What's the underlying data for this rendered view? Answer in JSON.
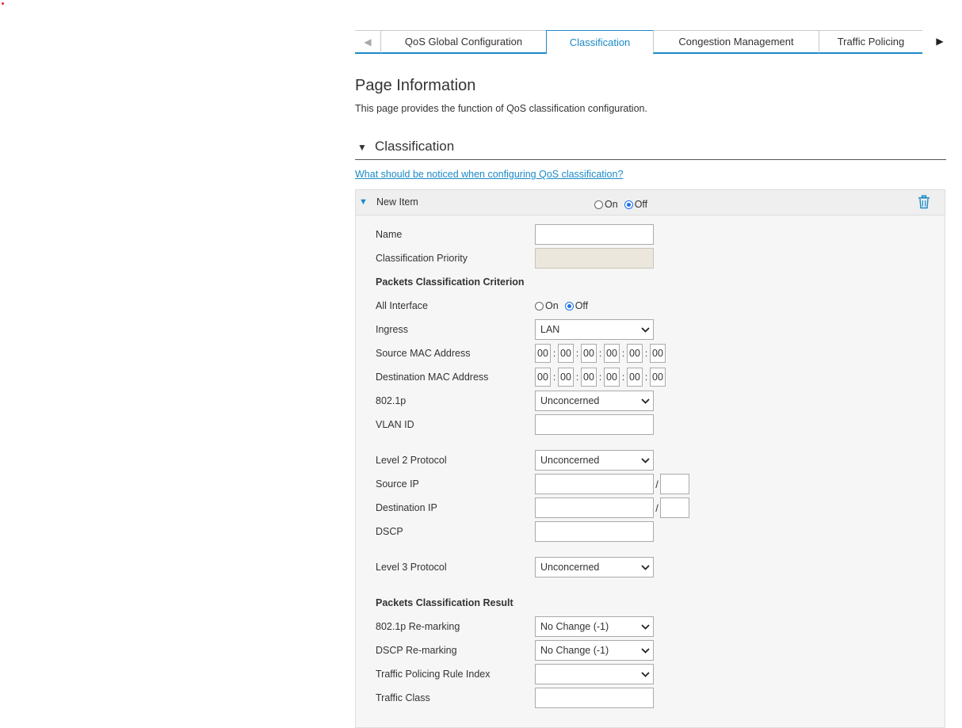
{
  "tabs": [
    {
      "label": "QoS Global Configuration",
      "active": false
    },
    {
      "label": "Classification",
      "active": true
    },
    {
      "label": "Congestion Management",
      "active": false
    },
    {
      "label": "Traffic Policing",
      "active": false
    }
  ],
  "page_info": {
    "title": "Page Information",
    "description": "This page provides the function of QoS classification configuration."
  },
  "section": {
    "title": "Classification",
    "help_link": "What should be noticed when configuring QoS classification?"
  },
  "item": {
    "title": "New Item",
    "on_label": "On",
    "off_label": "Off",
    "state": "Off"
  },
  "form": {
    "name_label": "Name",
    "name_value": "",
    "priority_label": "Classification Priority",
    "priority_value": "",
    "criterion_heading": "Packets Classification Criterion",
    "all_interface_label": "All Interface",
    "all_interface_on": "On",
    "all_interface_off": "Off",
    "all_interface_state": "Off",
    "ingress_label": "Ingress",
    "ingress_value": "LAN",
    "src_mac_label": "Source MAC Address",
    "src_mac": [
      "00",
      "00",
      "00",
      "00",
      "00",
      "00"
    ],
    "dst_mac_label": "Destination MAC Address",
    "dst_mac": [
      "00",
      "00",
      "00",
      "00",
      "00",
      "00"
    ],
    "dot1p_label": "802.1p",
    "dot1p_value": "Unconcerned",
    "vlan_label": "VLAN ID",
    "vlan_value": "",
    "l2_label": "Level 2 Protocol",
    "l2_value": "Unconcerned",
    "src_ip_label": "Source IP",
    "dst_ip_label": "Destination IP",
    "ip_separator": "/",
    "dscp_label": "DSCP",
    "dscp_value": "",
    "l3_label": "Level 3 Protocol",
    "l3_value": "Unconcerned",
    "result_heading": "Packets Classification Result",
    "dot1p_remark_label": "802.1p Re-marking",
    "dot1p_remark_value": "No Change (-1)",
    "dscp_remark_label": "DSCP Re-marking",
    "dscp_remark_value": "No Change (-1)",
    "policing_label": "Traffic Policing Rule Index",
    "policing_value": "",
    "traffic_class_label": "Traffic Class",
    "traffic_class_value": ""
  },
  "colors": {
    "accent": "#1b8ac7",
    "radio": "#1b73e8",
    "disabled_field": "#ebe7dc"
  },
  "icons": {
    "prev": "triangle-left-icon",
    "next": "triangle-right-icon",
    "collapse": "triangle-down-icon",
    "delete": "trash-icon",
    "dropdown": "chevron-down-icon"
  }
}
